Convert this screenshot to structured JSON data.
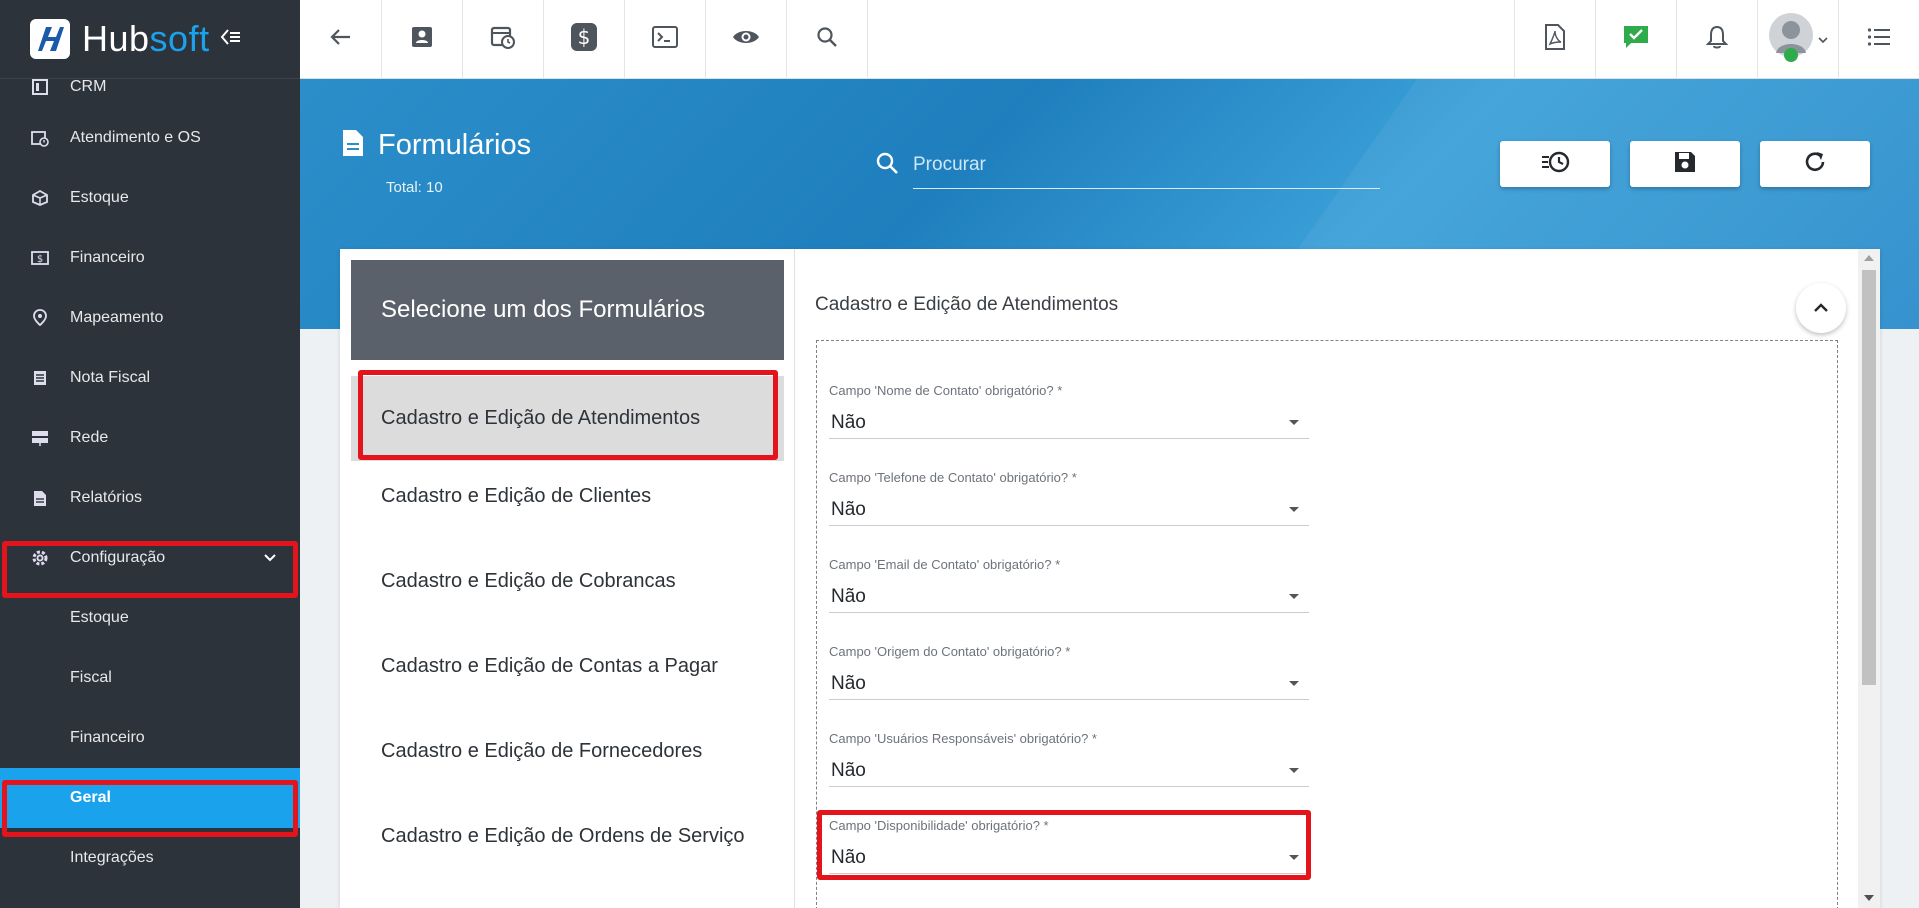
{
  "brand": {
    "name_part1": "Hub",
    "name_part2": "soft"
  },
  "sidebar": {
    "items": [
      {
        "label": "CRM",
        "icon": "crm-board-icon"
      },
      {
        "label": "Atendimento e OS",
        "icon": "calendar-clock-icon"
      },
      {
        "label": "Estoque",
        "icon": "box-icon"
      },
      {
        "label": "Financeiro",
        "icon": "money-icon"
      },
      {
        "label": "Mapeamento",
        "icon": "map-pin-icon"
      },
      {
        "label": "Nota Fiscal",
        "icon": "invoice-icon"
      },
      {
        "label": "Rede",
        "icon": "server-icon"
      },
      {
        "label": "Relatórios",
        "icon": "report-icon"
      },
      {
        "label": "Configuração",
        "icon": "gear-icon"
      }
    ],
    "subitems": [
      {
        "label": "Estoque"
      },
      {
        "label": "Fiscal"
      },
      {
        "label": "Financeiro"
      },
      {
        "label": "Geral"
      },
      {
        "label": "Integrações"
      }
    ]
  },
  "header": {
    "title": "Formulários",
    "total": "Total: 10",
    "search_placeholder": "Procurar"
  },
  "forms": {
    "list_title": "Selecione um dos Formulários",
    "items": [
      "Cadastro e Edição de Atendimentos",
      "Cadastro e Edição de Clientes",
      "Cadastro e Edição de Cobrancas",
      "Cadastro e Edição de Contas a Pagar",
      "Cadastro e Edição de Fornecedores",
      "Cadastro e Edição de Ordens de Serviço"
    ]
  },
  "detail": {
    "title": "Cadastro e Edição de Atendimentos",
    "fields": [
      {
        "label": "Campo 'Nome de Contato' obrigatório? *",
        "value": "Não"
      },
      {
        "label": "Campo 'Telefone de Contato' obrigatório? *",
        "value": "Não"
      },
      {
        "label": "Campo 'Email de Contato' obrigatório? *",
        "value": "Não"
      },
      {
        "label": "Campo 'Origem do Contato' obrigatório? *",
        "value": "Não"
      },
      {
        "label": "Campo 'Usuários Responsáveis' obrigatório? *",
        "value": "Não"
      },
      {
        "label": "Campo 'Disponibilidade' obrigatório? *",
        "value": "Não"
      }
    ]
  },
  "colors": {
    "sidebar": "#2d333b",
    "accent": "#1aa3ec",
    "highlight": "#e3141b",
    "header": "#2b8ec9"
  }
}
